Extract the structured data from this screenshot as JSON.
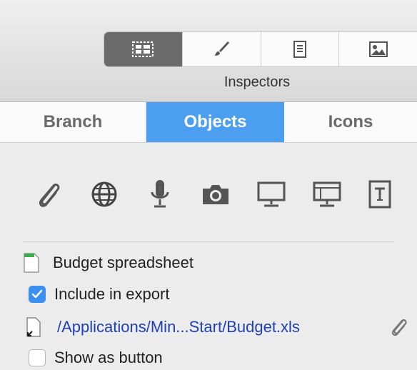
{
  "toolbar": {
    "segments": [
      {
        "icon": "object-inspector-icon",
        "selected": true
      },
      {
        "icon": "style-brush-icon",
        "selected": false
      },
      {
        "icon": "document-icon",
        "selected": false
      },
      {
        "icon": "image-icon",
        "selected": false
      }
    ],
    "label": "Inspectors"
  },
  "tabs": {
    "items": [
      {
        "label": "Branch",
        "selected": false
      },
      {
        "label": "Objects",
        "selected": true
      },
      {
        "label": "Icons",
        "selected": false
      }
    ]
  },
  "object_types": [
    "paperclip-icon",
    "globe-icon",
    "microphone-icon",
    "camera-icon",
    "monitor-icon",
    "presentation-icon",
    "text-frame-icon"
  ],
  "attachment": {
    "name": "Budget spreadsheet",
    "include_label": "Include in export",
    "include_checked": true,
    "path": "/Applications/Min...Start/Budget.xls",
    "show_as_button_label": "Show as button",
    "show_as_button_checked": false
  },
  "colors": {
    "accent": "#4c9ff0",
    "link": "#1f3fb8",
    "selected_segment": "#6b6b6b"
  }
}
